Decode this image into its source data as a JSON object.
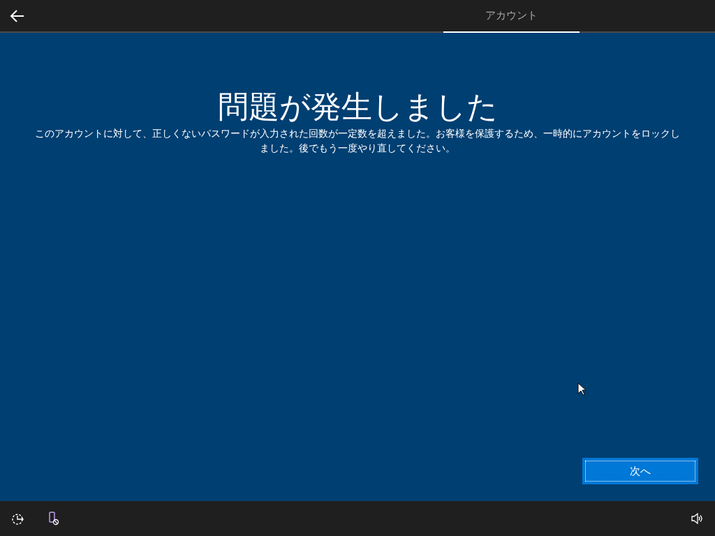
{
  "tabs": [
    {
      "label": "アカウント",
      "selected": true
    }
  ],
  "title": "問題が発生しました",
  "message": "このアカウントに対して、正しくないパスワードが入力された回数が一定数を超えました。お客様を保護するため、一時的にアカウントをロックしました。後でもう一度やり直してください。",
  "next_button": "次へ"
}
